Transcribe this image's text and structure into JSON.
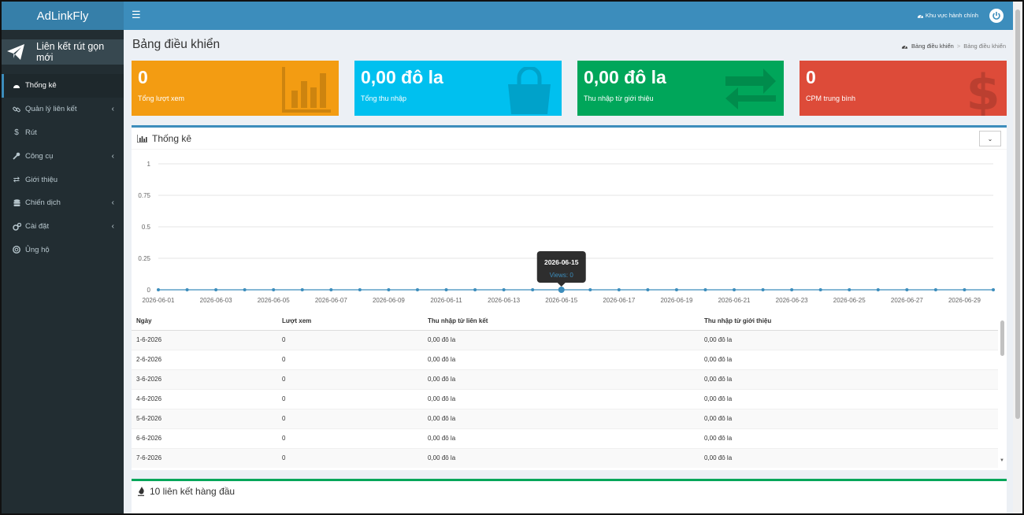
{
  "app": {
    "title": "AdLinkFly"
  },
  "sidebar": {
    "new_link_label": "Liên kết rút gọn mới",
    "items": [
      {
        "label": "Thống kê",
        "icon": "dashboard-icon",
        "active": true,
        "has_children": false
      },
      {
        "label": "Quản lý liên kết",
        "icon": "link-icon",
        "active": false,
        "has_children": true
      },
      {
        "label": "Rút",
        "icon": "dollar-icon",
        "active": false,
        "has_children": false
      },
      {
        "label": "Công cụ",
        "icon": "wrench-icon",
        "active": false,
        "has_children": true
      },
      {
        "label": "Giới thiệu",
        "icon": "exchange-icon",
        "active": false,
        "has_children": false
      },
      {
        "label": "Chiến dịch",
        "icon": "database-icon",
        "active": false,
        "has_children": true
      },
      {
        "label": "Cài đặt",
        "icon": "gears-icon",
        "active": false,
        "has_children": true
      },
      {
        "label": "Ủng hộ",
        "icon": "lifebuoy-icon",
        "active": false,
        "has_children": false
      }
    ]
  },
  "header": {
    "admin_area": "Khu vực hành chính"
  },
  "page": {
    "title": "Bảng điều khiển",
    "breadcrumb": {
      "home": "Bảng điều khiển",
      "current": "Bảng điều khiển"
    }
  },
  "stats": [
    {
      "value": "0",
      "label": "Tổng lượt xem",
      "color": "#f39c12",
      "icon": "bar-chart-icon"
    },
    {
      "value": "0,00 đô la",
      "label": "Tổng thu nhập",
      "color": "#00c0ef",
      "icon": "shopping-bag-icon"
    },
    {
      "value": "0,00 đô la",
      "label": "Thu nhập từ giới thiệu",
      "color": "#00a65a",
      "icon": "exchange-arrows-icon"
    },
    {
      "value": "0",
      "label": "CPM trung bình",
      "color": "#dd4b39",
      "icon": "dollar-sign-icon"
    }
  ],
  "stats_panel": {
    "title": "Thống kê"
  },
  "chart_data": {
    "type": "line",
    "x": [
      "2026-06-01",
      "2026-06-02",
      "2026-06-03",
      "2026-06-04",
      "2026-06-05",
      "2026-06-06",
      "2026-06-07",
      "2026-06-08",
      "2026-06-09",
      "2026-06-10",
      "2026-06-11",
      "2026-06-12",
      "2026-06-13",
      "2026-06-14",
      "2026-06-15",
      "2026-06-16",
      "2026-06-17",
      "2026-06-18",
      "2026-06-19",
      "2026-06-20",
      "2026-06-21",
      "2026-06-22",
      "2026-06-23",
      "2026-06-24",
      "2026-06-25",
      "2026-06-26",
      "2026-06-27",
      "2026-06-28",
      "2026-06-29",
      "2026-06-30"
    ],
    "x_tick_labels": [
      "2026-06-01",
      "2026-06-03",
      "2026-06-05",
      "2026-06-07",
      "2026-06-09",
      "2026-06-11",
      "2026-06-13",
      "2026-06-15",
      "2026-06-17",
      "2026-06-19",
      "2026-06-21",
      "2026-06-23",
      "2026-06-25",
      "2026-06-27",
      "2026-06-29"
    ],
    "series": [
      {
        "values": [
          0,
          0,
          0,
          0,
          0,
          0,
          0,
          0,
          0,
          0,
          0,
          0,
          0,
          0,
          0,
          0,
          0,
          0,
          0,
          0,
          0,
          0,
          0,
          0,
          0,
          0,
          0,
          0,
          0,
          0
        ],
        "color": "#3c8dbc"
      }
    ],
    "ylim": [
      0,
      1
    ],
    "y_ticks": [
      "0",
      "0.25",
      "0.5",
      "0.75",
      "1"
    ],
    "grid": true,
    "tooltip": {
      "title": "2026-06-15",
      "text": "Views: 0",
      "index": 14
    }
  },
  "table": {
    "headers": [
      "Ngày",
      "Lượt xem",
      "Thu nhập từ liên kết",
      "Thu nhập từ giới thiệu"
    ],
    "rows": [
      [
        "1-6-2026",
        "0",
        "0,00 đô la",
        "0,00 đô la"
      ],
      [
        "2-6-2026",
        "0",
        "0,00 đô la",
        "0,00 đô la"
      ],
      [
        "3-6-2026",
        "0",
        "0,00 đô la",
        "0,00 đô la"
      ],
      [
        "4-6-2026",
        "0",
        "0,00 đô la",
        "0,00 đô la"
      ],
      [
        "5-6-2026",
        "0",
        "0,00 đô la",
        "0,00 đô la"
      ],
      [
        "6-6-2026",
        "0",
        "0,00 đô la",
        "0,00 đô la"
      ],
      [
        "7-6-2026",
        "0",
        "0,00 đô la",
        "0,00 đô la"
      ]
    ]
  },
  "top_links_panel": {
    "title": "10 liên kết hàng đầu"
  }
}
